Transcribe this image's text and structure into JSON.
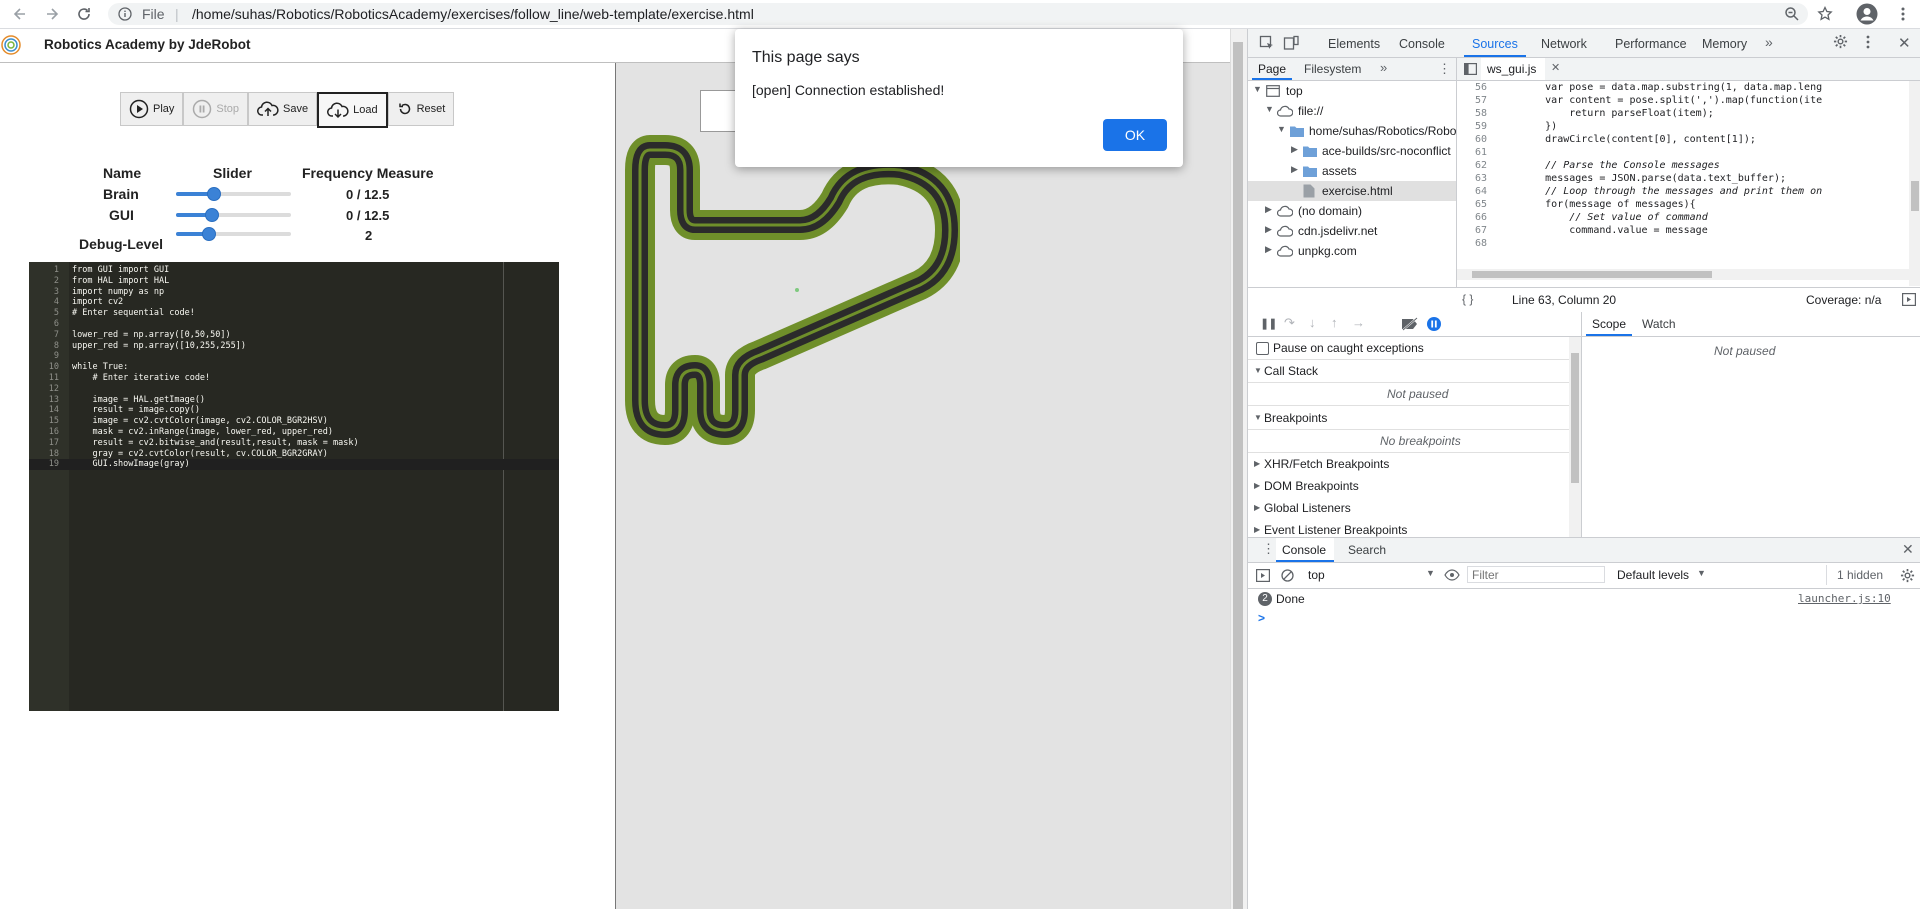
{
  "browser": {
    "scheme": "File",
    "url": "/home/suhas/Robotics/RoboticsAcademy/exercises/follow_line/web-template/exercise.html"
  },
  "app": {
    "title": "Robotics Academy by JdeRobot",
    "buttons": {
      "play": "Play",
      "stop": "Stop",
      "save": "Save",
      "load": "Load",
      "reset": "Reset"
    },
    "table": {
      "col_name": "Name",
      "col_slider": "Slider",
      "col_freq": "Frequency Measure",
      "rows": [
        {
          "name": "Brain",
          "freq": "0 / 12.5",
          "slider_value": 0.33
        },
        {
          "name": "GUI",
          "freq": "0 / 12.5",
          "slider_value": 0.31
        },
        {
          "name": "Debug-Level",
          "freq": "2",
          "slider_value": 0.29
        }
      ]
    },
    "editor_lines": [
      {
        "num": "1",
        "text": "from GUI import GUI"
      },
      {
        "num": "2",
        "text": "from HAL import HAL"
      },
      {
        "num": "3",
        "text": "import numpy as np"
      },
      {
        "num": "4",
        "text": "import cv2"
      },
      {
        "num": "5",
        "text": "# Enter sequential code!"
      },
      {
        "num": "6",
        "text": ""
      },
      {
        "num": "7",
        "text": "lower_red = np.array([0,50,50])"
      },
      {
        "num": "8",
        "text": "upper_red = np.array([10,255,255])"
      },
      {
        "num": "9",
        "text": ""
      },
      {
        "num": "10",
        "text": "while True:"
      },
      {
        "num": "11",
        "text": "    # Enter iterative code!"
      },
      {
        "num": "12",
        "text": ""
      },
      {
        "num": "13",
        "text": "    image = HAL.getImage()"
      },
      {
        "num": "14",
        "text": "    result = image.copy()"
      },
      {
        "num": "15",
        "text": "    image = cv2.cvtColor(image, cv2.COLOR_BGR2HSV)"
      },
      {
        "num": "16",
        "text": "    mask = cv2.inRange(image, lower_red, upper_red)"
      },
      {
        "num": "17",
        "text": "    result = cv2.bitwise_and(result,result, mask = mask)"
      },
      {
        "num": "18",
        "text": "    gray = cv2.cvtColor(result, cv.COLOR_BGR2GRAY)"
      },
      {
        "num": "19",
        "text": "    GUI.showImage(gray)"
      }
    ]
  },
  "dialog": {
    "title": "This page says",
    "message": "[open] Connection established!",
    "ok": "OK"
  },
  "devtools": {
    "tabs": [
      "Elements",
      "Console",
      "Sources",
      "Network",
      "Performance",
      "Memory"
    ],
    "active_tab": "Sources",
    "nav_tabs": {
      "page": "Page",
      "filesystem": "Filesystem"
    },
    "tree": {
      "top": "top",
      "file": "file://",
      "home": "home/suhas/Robotics/Robo",
      "ace": "ace-builds/src-noconflict",
      "assets": "assets",
      "exercise": "exercise.html",
      "nodomain": "(no domain)",
      "cdn": "cdn.jsdelivr.net",
      "unpkg": "unpkg.com"
    },
    "editor_tab": "ws_gui.js",
    "source_lines": [
      {
        "num": "56",
        "text": "        var pose = data.map.substring(1, data.map.leng"
      },
      {
        "num": "57",
        "text": "        var content = pose.split(',').map(function(ite"
      },
      {
        "num": "58",
        "text": "            return parseFloat(item);"
      },
      {
        "num": "59",
        "text": "        })"
      },
      {
        "num": "60",
        "text": "        drawCircle(content[0], content[1]);"
      },
      {
        "num": "61",
        "text": ""
      },
      {
        "num": "62",
        "text": "        // Parse the Console messages"
      },
      {
        "num": "63",
        "text": "        messages = JSON.parse(data.text_buffer);"
      },
      {
        "num": "64",
        "text": "        // Loop through the messages and print them on"
      },
      {
        "num": "65",
        "text": "        for(message of messages){"
      },
      {
        "num": "66",
        "text": "            // Set value of command"
      },
      {
        "num": "67",
        "text": "            command.value = message"
      },
      {
        "num": "68",
        "text": ""
      }
    ],
    "status": {
      "position": "Line 63, Column 20",
      "coverage": "Coverage: n/a"
    },
    "scope_tabs": {
      "scope": "Scope",
      "watch": "Watch"
    },
    "not_paused": "Not paused",
    "pause_caught": "Pause on caught exceptions",
    "sections": {
      "call_stack": "Call Stack",
      "breakpoints": "Breakpoints",
      "no_breakpoints": "No breakpoints",
      "xhr": "XHR/Fetch Breakpoints",
      "dom": "DOM Breakpoints",
      "global": "Global Listeners",
      "event": "Event Listener Breakpoints"
    },
    "drawer": {
      "console_tab": "Console",
      "search_tab": "Search",
      "context": "top",
      "filter_placeholder": "Filter",
      "levels": "Default levels",
      "hidden": "1 hidden",
      "badge": "2",
      "message": "Done",
      "source": "launcher.js:10",
      "prompt": ">"
    }
  },
  "colors": {
    "accent": "#1a73e8",
    "track_outer": "#6f8f2a",
    "track_inner": "#2b2b2b",
    "editor_bg": "#272822"
  }
}
